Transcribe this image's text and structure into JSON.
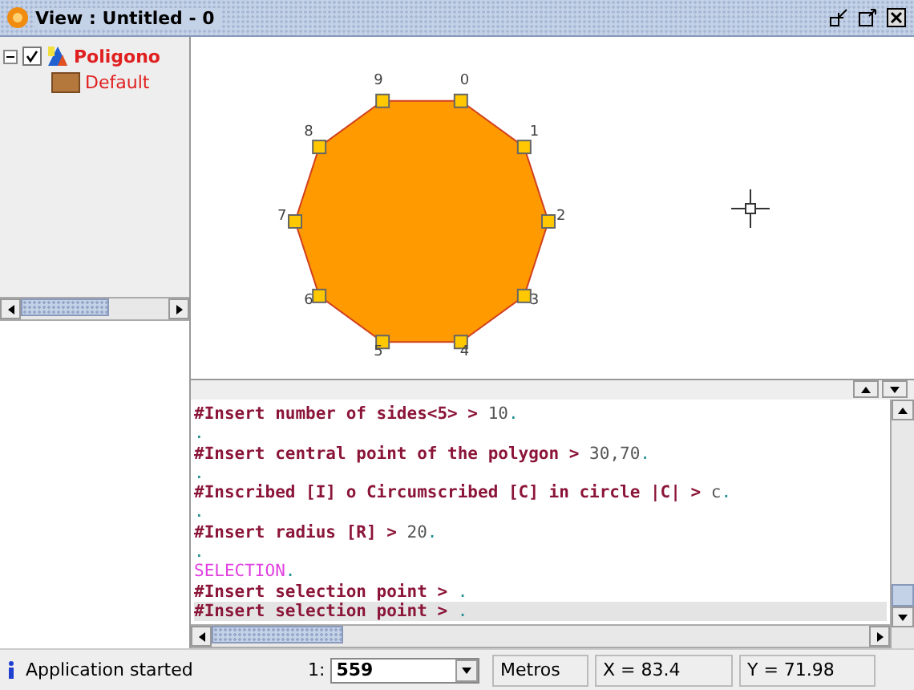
{
  "window": {
    "title": "View : Untitled - 0"
  },
  "layers": [
    {
      "label": "Poligono",
      "expanded": true,
      "checked": true,
      "children": [
        {
          "label": "Default",
          "color": "#b4783c"
        }
      ]
    }
  ],
  "map": {
    "vertices": [
      {
        "label": "0"
      },
      {
        "label": "1"
      },
      {
        "label": "2"
      },
      {
        "label": "3"
      },
      {
        "label": "4"
      },
      {
        "label": "5"
      },
      {
        "label": "6"
      },
      {
        "label": "7"
      },
      {
        "label": "8"
      },
      {
        "label": "9"
      }
    ]
  },
  "console": {
    "lines": [
      {
        "kind": "prompt",
        "prompt": "#Insert number of sides<5> >",
        "answer": "10",
        "end": ".",
        "selected": false
      },
      {
        "kind": "dot",
        "end": ".",
        "selected": false
      },
      {
        "kind": "prompt",
        "prompt": "#Insert central point of the polygon >",
        "answer": "30,70",
        "end": ".",
        "selected": false
      },
      {
        "kind": "dot",
        "end": ".",
        "selected": false
      },
      {
        "kind": "prompt",
        "prompt": "#Inscribed [I] o Circumscribed [C] in circle |C| >",
        "answer": "c",
        "end": ".",
        "selected": false
      },
      {
        "kind": "dot",
        "end": ".",
        "selected": false
      },
      {
        "kind": "prompt",
        "prompt": "#Insert radius [R] >",
        "answer": "20",
        "end": ".",
        "selected": false
      },
      {
        "kind": "dot",
        "end": ".",
        "selected": false
      },
      {
        "kind": "command",
        "command": "SELECTION",
        "end": ".",
        "selected": false
      },
      {
        "kind": "prompt",
        "prompt": "#Insert selection point >",
        "end": ".",
        "selected": false
      },
      {
        "kind": "prompt",
        "prompt": "#Insert selection point >",
        "end": ".",
        "selected": true
      }
    ]
  },
  "status_bar": {
    "message": "Application started",
    "scale_label": "1:",
    "scale": "559",
    "units": "Metros",
    "x": "X = 83.4",
    "y": "Y = 71.98"
  }
}
